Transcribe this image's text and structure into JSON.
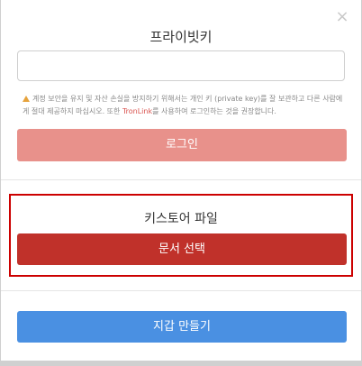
{
  "close_label": "×",
  "private_key": {
    "title": "프라이빗키",
    "value": "",
    "placeholder": "",
    "warning_before": "계정 보안을 유지 및 자산 손실을 방지하기 위해서는 개인 키 (private key)를 잘 보관하고 다른 사람에게 절대 제공하지 마십시오. 또한 ",
    "warning_link": "TronLink",
    "warning_after": "를 사용하여 로그인하는 것을 권장합니다.",
    "login_label": "로그인"
  },
  "keystore": {
    "title": "키스토어 파일",
    "select_label": "문서 선택"
  },
  "create_wallet_label": "지갑 만들기",
  "colors": {
    "login_button": "#e8918b",
    "select_button": "#c0312a",
    "create_button": "#4a90e2",
    "highlight_border": "#cc0000"
  }
}
